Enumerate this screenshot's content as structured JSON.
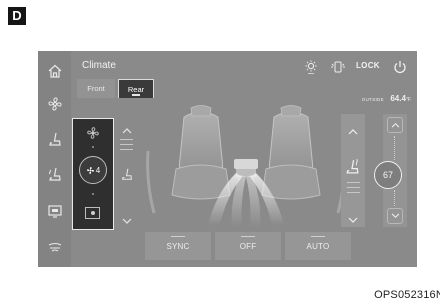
{
  "section_label": "D",
  "figure_code": "OPS052316N",
  "screen": {
    "title": "Climate",
    "tabs": [
      {
        "label": "Front",
        "active": false
      },
      {
        "label": "Rear",
        "active": true
      }
    ],
    "lock_label": "LOCK",
    "outside_label": "OUTSIDE",
    "outside_value": "64.4",
    "outside_unit": "°F",
    "rear_fan_level": "4",
    "temperature": "67",
    "bottom_buttons": [
      "SYNC",
      "OFF",
      "AUTO"
    ],
    "nav_icons": [
      "home-icon",
      "fan-icon",
      "seat-heat-icon",
      "seat-vent-icon",
      "display-icon",
      "defrost-icon"
    ]
  }
}
